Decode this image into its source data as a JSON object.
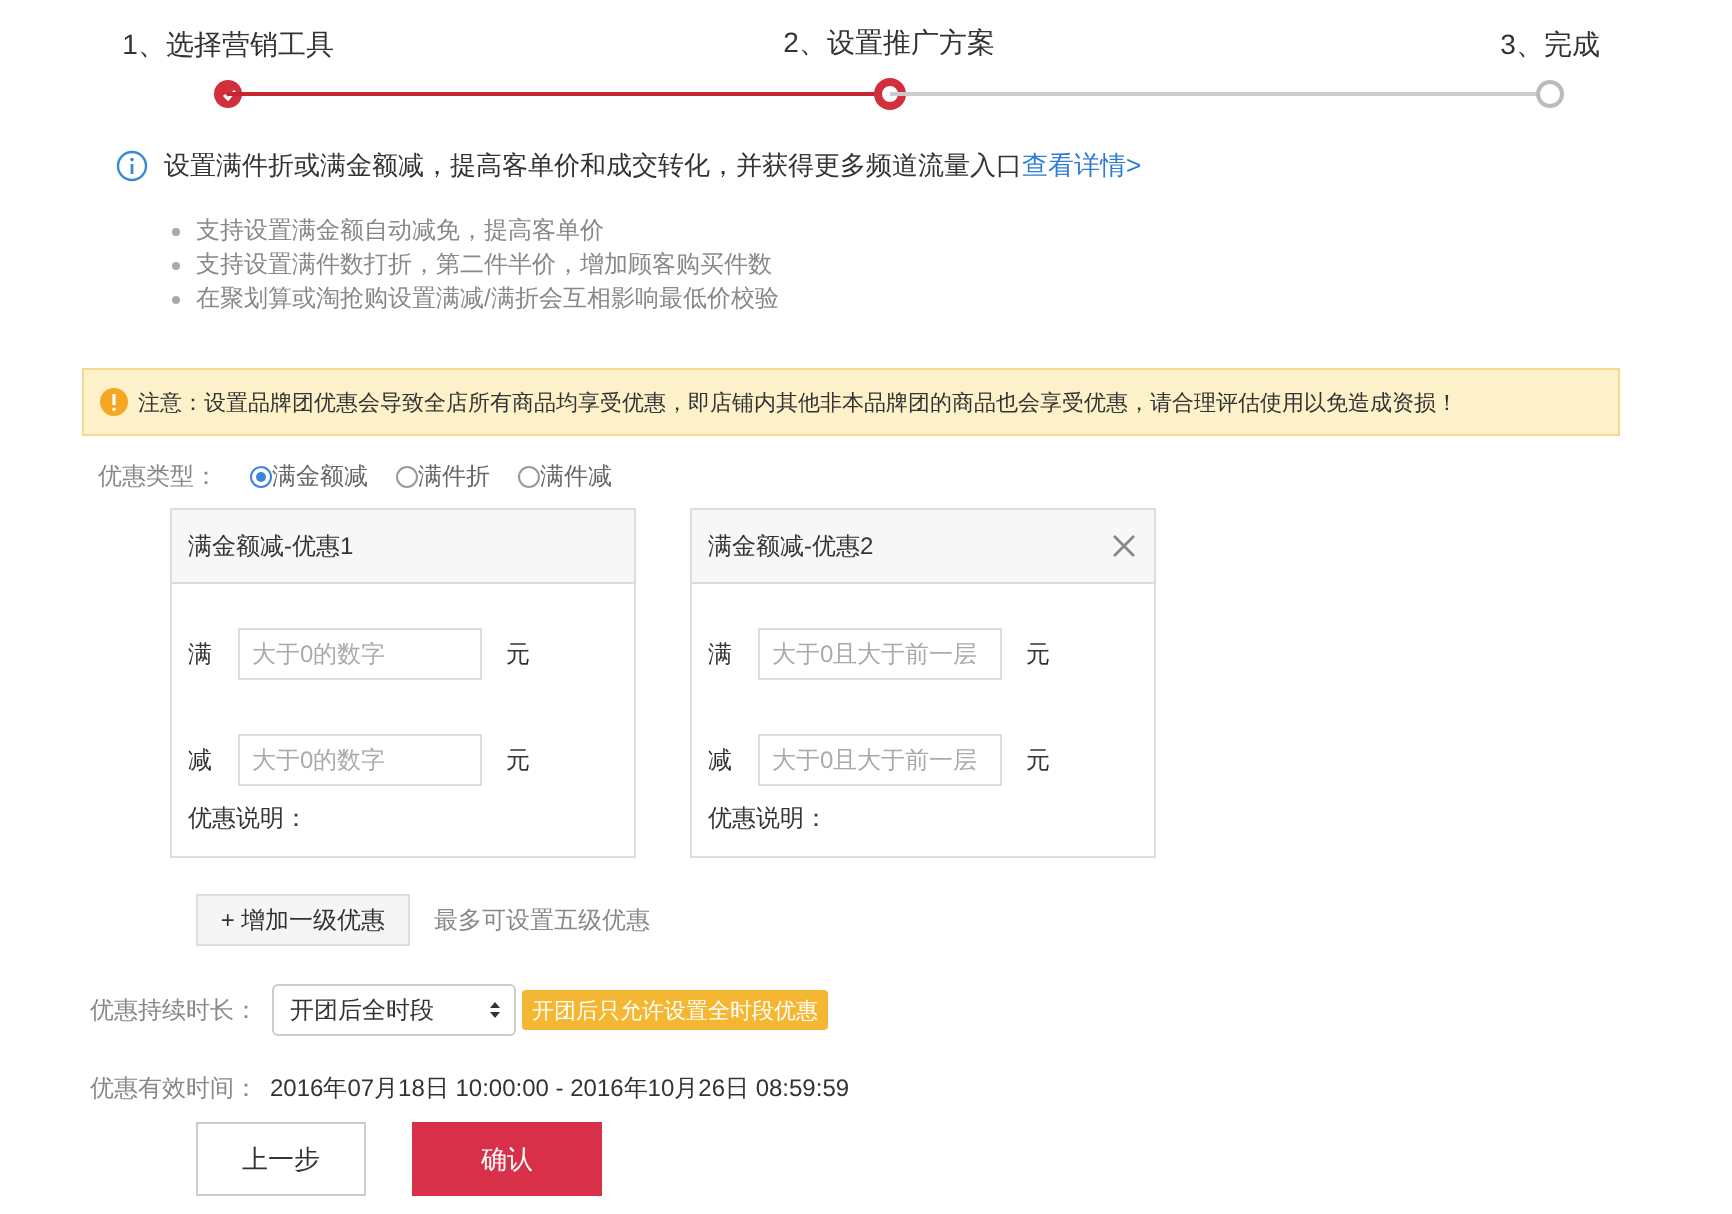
{
  "steps": [
    {
      "label": "1、选择营销工具",
      "completed": true,
      "current": false
    },
    {
      "label": "2、设置推广方案",
      "completed": false,
      "current": true
    },
    {
      "label": "3、完成",
      "completed": false,
      "current": false
    }
  ],
  "intro": {
    "text": "设置满件折或满金额减，提高客单价和成交转化，并获得更多频道流量入口",
    "link": "查看详情>"
  },
  "tips": [
    "支持设置满金额自动减免，提高客单价",
    "支持设置满件数打折，第二件半价，增加顾客购买件数",
    "在聚划算或淘抢购设置满减/满折会互相影响最低价校验"
  ],
  "notice": "注意：设置品牌团优惠会导致全店所有商品均享受优惠，即店铺内其他非本品牌团的商品也会享受优惠，请合理评估使用以免造成资损！",
  "discount_type": {
    "label": "优惠类型：",
    "options": [
      {
        "label": "满金额减",
        "selected": true
      },
      {
        "label": "满件折",
        "selected": false
      },
      {
        "label": "满件减",
        "selected": false
      }
    ]
  },
  "tiers": [
    {
      "title": "满金额减-优惠1",
      "closable": false,
      "rows": [
        {
          "label": "满",
          "placeholder": "大于0的数字",
          "unit": "元"
        },
        {
          "label": "减",
          "placeholder": "大于0的数字",
          "unit": "元"
        }
      ],
      "note_label": "优惠说明："
    },
    {
      "title": "满金额减-优惠2",
      "closable": true,
      "rows": [
        {
          "label": "满",
          "placeholder": "大于0且大于前一层",
          "unit": "元"
        },
        {
          "label": "减",
          "placeholder": "大于0且大于前一层",
          "unit": "元"
        }
      ],
      "note_label": "优惠说明："
    }
  ],
  "add_button": "+ 增加一级优惠",
  "add_hint": "最多可设置五级优惠",
  "duration": {
    "label": "优惠持续时长：",
    "value": "开团后全时段",
    "badge": "开团后只允许设置全时段优惠"
  },
  "validity": {
    "label": "优惠有效时间：",
    "value": "2016年07月18日 10:00:00 - 2016年10月26日 08:59:59"
  },
  "buttons": [
    {
      "label": "上一步",
      "kind": "secondary"
    },
    {
      "label": "确认",
      "kind": "primary"
    }
  ]
}
